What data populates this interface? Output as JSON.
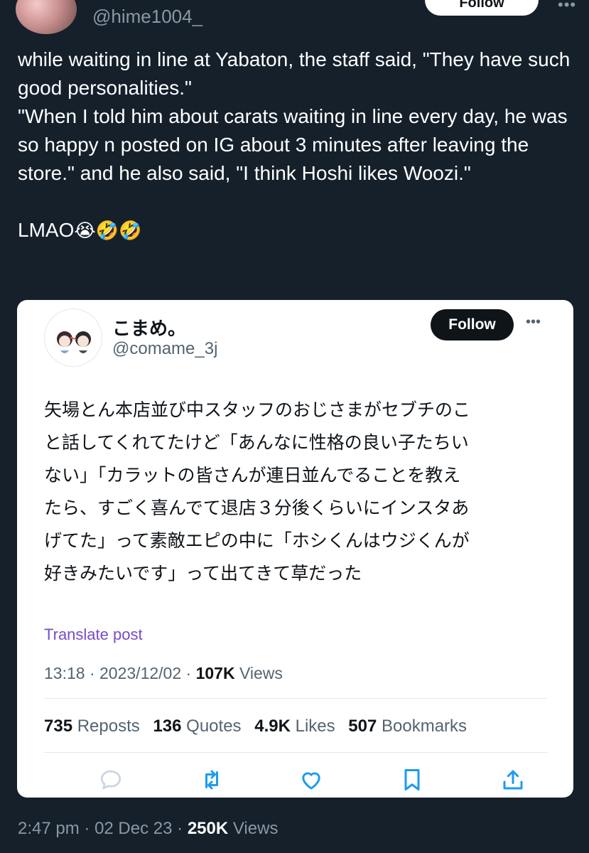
{
  "outer_tweet": {
    "handle": "@hime1004_",
    "follow_label": "Follow",
    "more_label": "•••",
    "text_lines": [
      "while waiting in line at Yabaton, the staff said, \"They have such good personalities.\"",
      "\"When I told him about carats waiting in line every day, he was so happy n posted on IG about 3 minutes after leaving the store.\" and he also said, \"I think Hoshi likes Woozi.\"",
      "LMAO"
    ],
    "emojis": "😭🤣🤣",
    "time": "2:47 pm",
    "date": "02 Dec 23",
    "views_count": "250K",
    "views_label": "Views"
  },
  "quoted_tweet": {
    "display_name": "こまめ。",
    "handle": "@comame_3j",
    "follow_label": "Follow",
    "more_label": "•••",
    "text": "矢場とん本店並び中スタッフのおじさまがセブチのこ\nと話してくれてたけど「あんなに性格の良い子たちい\nない」「カラットの皆さんが連日並んでることを教え\nたら、すごく喜んでて退店３分後くらいにインスタあ\nげてた」って素敵エピの中に「ホシくんはウジくんが\n好きみたいです」って出てきて草だった",
    "translate_label": "Translate post",
    "time": "13:18",
    "date": "2023/12/02",
    "views_count": "107K",
    "views_label": "Views",
    "stats": {
      "reposts_count": "735",
      "reposts_label": "Reposts",
      "quotes_count": "136",
      "quotes_label": "Quotes",
      "likes_count": "4.9K",
      "likes_label": "Likes",
      "bookmarks_count": "507",
      "bookmarks_label": "Bookmarks"
    },
    "actions": [
      "reply-icon",
      "repost-icon",
      "like-icon",
      "bookmark-icon",
      "share-icon"
    ]
  },
  "colors": {
    "background": "#15202b",
    "card": "#ffffff",
    "secondary_text": "#8b98a5",
    "link_purple": "#794bc4",
    "icon_blue": "#1d9bf0"
  },
  "separator": "·"
}
